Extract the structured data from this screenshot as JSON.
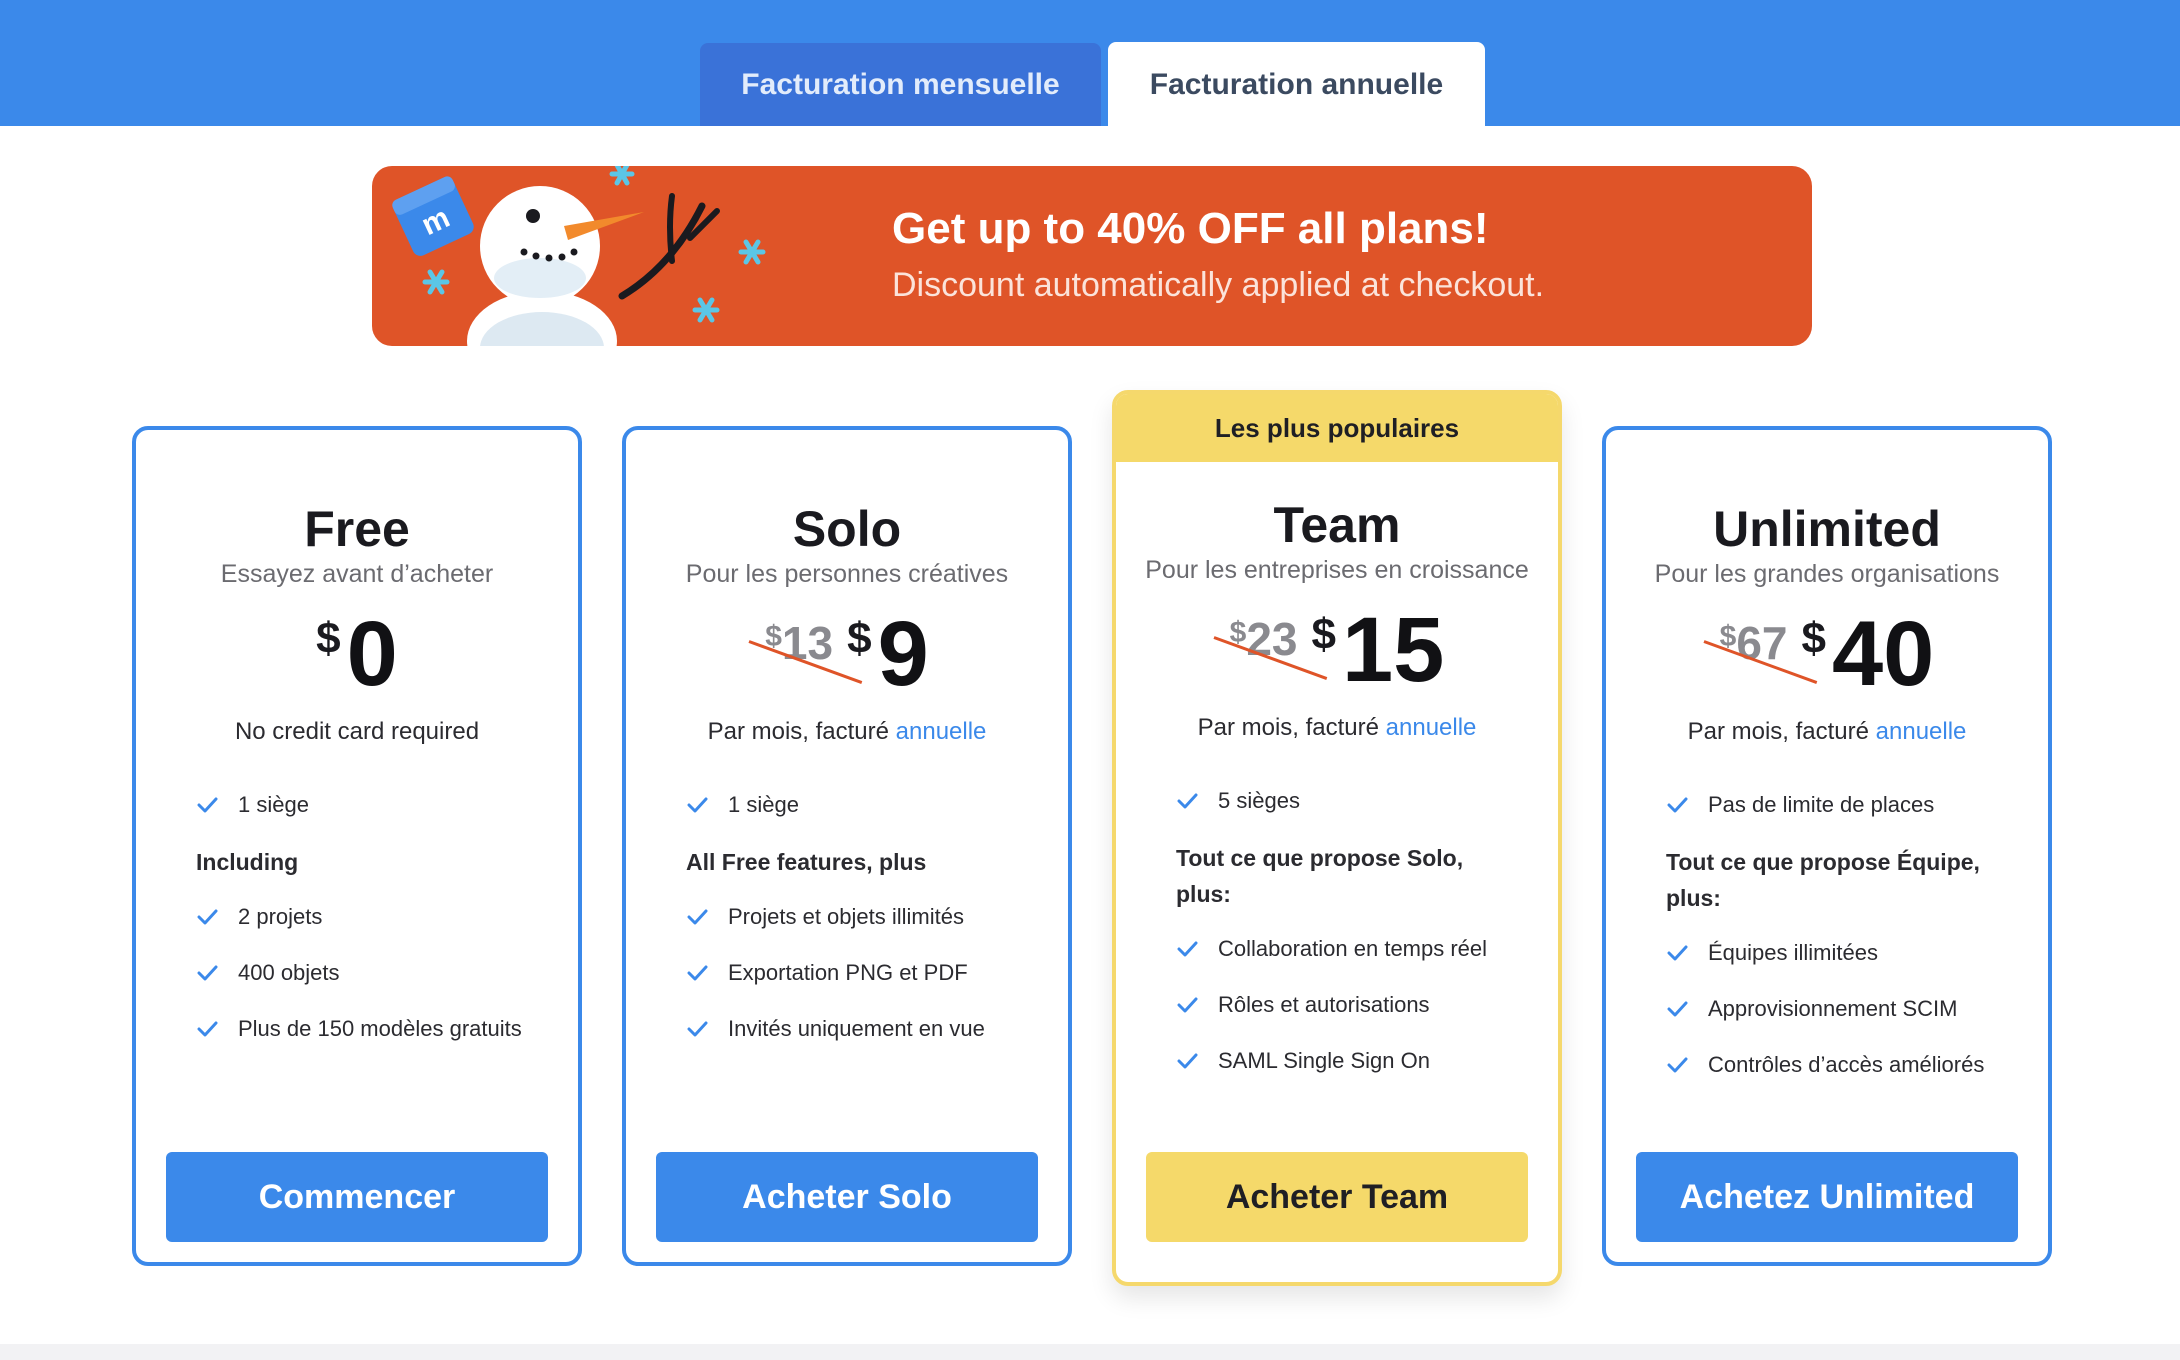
{
  "tabs": {
    "monthly": "Facturation mensuelle",
    "annual": "Facturation annuelle"
  },
  "promo": {
    "title": "Get up to 40% OFF all plans!",
    "subtitle": "Discount automatically applied at checkout."
  },
  "colors": {
    "brand_blue": "#3b89ea",
    "promo_orange": "#df5428",
    "popular_yellow": "#f5d96a"
  },
  "plans": [
    {
      "name": "Free",
      "tagline": "Essayez avant d’acheter",
      "currency": "$",
      "price": "0",
      "note": "No credit card required",
      "features_top": [
        "1 siège"
      ],
      "section": "Including",
      "features": [
        "2 projets",
        "400 objets",
        "Plus de 150 modèles gratuits"
      ],
      "cta": "Commencer"
    },
    {
      "name": "Solo",
      "tagline": "Pour les personnes créatives",
      "old_price": "13",
      "currency": "$",
      "price": "9",
      "billing_prefix": "Par mois, facturé ",
      "billing_link": "annuelle",
      "features_top": [
        "1 siège"
      ],
      "section": "All Free features, plus",
      "features": [
        "Projets et objets illimités",
        "Exportation PNG et PDF",
        "Invités uniquement en vue"
      ],
      "cta": "Acheter Solo"
    },
    {
      "badge": "Les plus populaires",
      "name": "Team",
      "tagline": "Pour les entreprises en croissance",
      "old_price": "23",
      "currency": "$",
      "price": "15",
      "billing_prefix": "Par mois, facturé ",
      "billing_link": "annuelle",
      "features_top": [
        "5 sièges"
      ],
      "section": "Tout ce que propose Solo, plus:",
      "features": [
        "Collaboration en temps réel",
        "Rôles et autorisations",
        "SAML Single Sign On"
      ],
      "cta": "Acheter Team"
    },
    {
      "name": "Unlimited",
      "tagline": "Pour les grandes organisations",
      "old_price": "67",
      "currency": "$",
      "price": "40",
      "billing_prefix": "Par mois, facturé ",
      "billing_link": "annuelle",
      "features_top": [
        "Pas de limite de places"
      ],
      "section": "Tout ce que propose Équipe, plus:",
      "features": [
        "Équipes illimitées",
        "Approvisionnement SCIM",
        "Contrôles d’accès améliorés"
      ],
      "cta": "Achetez Unlimited"
    }
  ]
}
